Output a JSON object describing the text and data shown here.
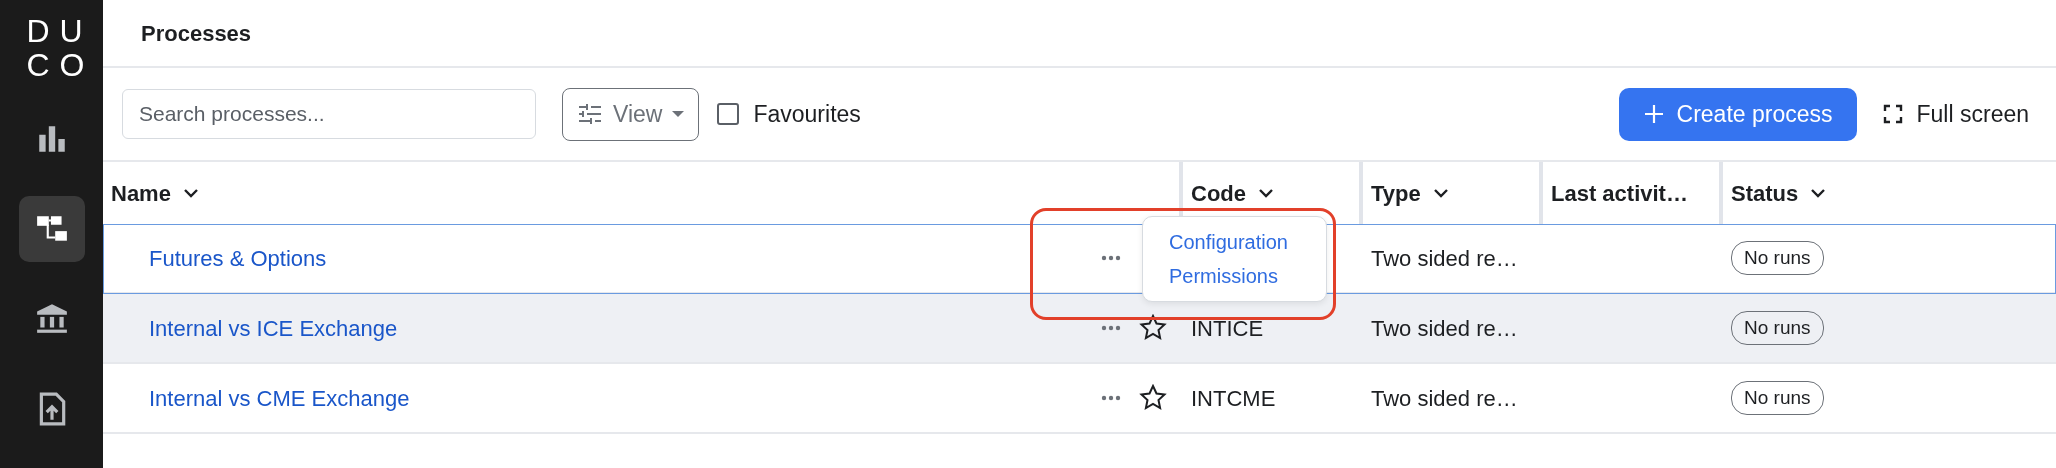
{
  "logo": "DUCO",
  "sidebar": {
    "items": [
      {
        "selected": false
      },
      {
        "selected": true
      },
      {
        "selected": false
      },
      {
        "selected": false
      }
    ]
  },
  "header": {
    "title": "Processes"
  },
  "toolbar": {
    "search": {
      "placeholder": "Search processes..."
    },
    "view_button": "View",
    "favourites": {
      "label": "Favourites",
      "checked": false
    },
    "create_button": "Create process",
    "full_screen": "Full screen"
  },
  "table": {
    "columns": [
      "Name",
      "Code",
      "Type",
      "Last activit…",
      "Status"
    ],
    "rows": [
      {
        "name": "Futures & Options",
        "selected": true,
        "hovered": false,
        "type": "Two sided re…",
        "status": "No runs",
        "menu": {
          "highlighted": true,
          "items": [
            "Configuration",
            "Permissions"
          ]
        }
      },
      {
        "name": "Internal vs ICE Exchange",
        "selected": false,
        "hovered": true,
        "starred": false,
        "code": "INTICE",
        "type": "Two sided re…",
        "status": "No runs"
      },
      {
        "name": "Internal vs CME Exchange",
        "selected": false,
        "hovered": false,
        "starred": false,
        "code": "INTCME",
        "type": "Two sided re…",
        "status": "No runs"
      }
    ]
  }
}
